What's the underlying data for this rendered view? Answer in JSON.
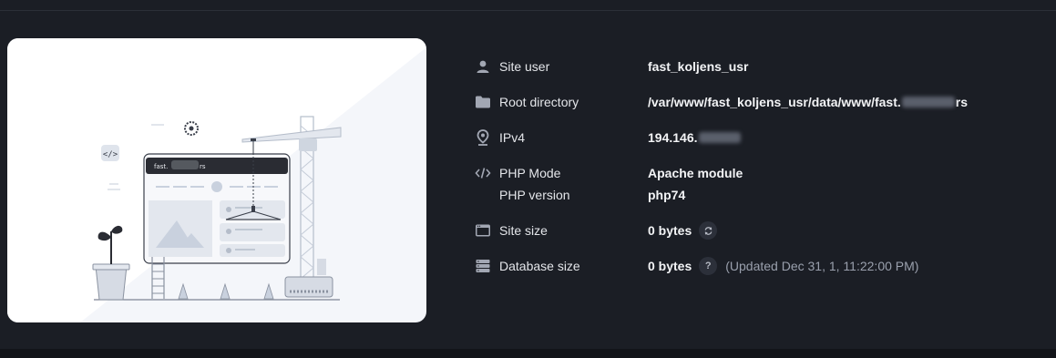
{
  "site_info": {
    "site_user": {
      "icon": "user-icon",
      "label": "Site user",
      "value": "fast_koljens_usr"
    },
    "root_directory": {
      "icon": "folder-icon",
      "label": "Root directory",
      "value_prefix": "/var/www/fast_koljens_usr/data/www/fast.",
      "value_suffix": "rs"
    },
    "ipv4": {
      "icon": "location-pin-icon",
      "label": "IPv4",
      "value_prefix": "194.146."
    },
    "php": {
      "icon": "code-icon",
      "mode_label": "PHP Mode",
      "mode_value": "Apache module",
      "version_label": "PHP version",
      "version_value": "php74"
    },
    "site_size": {
      "icon": "browser-window-icon",
      "label": "Site size",
      "value": "0 bytes",
      "action_icon": "refresh-icon"
    },
    "database_size": {
      "icon": "database-icon",
      "label": "Database size",
      "value": "0 bytes",
      "help_label": "?",
      "updated": "(Updated Dec 31, 1, 11:22:00 PM)"
    }
  },
  "illustration": {
    "domain_prefix": "fast.",
    "domain_suffix": "rs",
    "colors": {
      "card_bg": "#f4f6fa",
      "dark_bar": "#2a2c33",
      "accent": "#c9d1de"
    }
  }
}
